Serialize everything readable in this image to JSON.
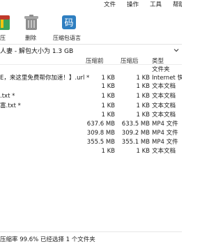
{
  "menu": {
    "items": [
      "文件",
      "操作",
      "工具",
      "帮助"
    ]
  },
  "toolbar": {
    "buttons": [
      {
        "label": "压",
        "icon": "zip-archive-icon"
      },
      {
        "label": "删除",
        "icon": "trash-bin-icon"
      },
      {
        "label": "压缩包语言",
        "icon": "language-book-icon"
      }
    ]
  },
  "address": {
    "path": "人妻 - 解包大小为 1.3 GB"
  },
  "columns": {
    "size": "压缩前",
    "packed": "压缩后",
    "type": "类型"
  },
  "rows": [
    {
      "name": "",
      "size": "",
      "packed": "",
      "type": "文件夹"
    },
    {
      "name": "E，来这里免费帮你加速！】.url *",
      "size": "1 KB",
      "packed": "1 KB",
      "type": "Internet 快捷方式"
    },
    {
      "name": "",
      "size": "1 KB",
      "packed": "1 KB",
      "type": "文本文档"
    },
    {
      "name": ".txt *",
      "size": "1 KB",
      "packed": "1 KB",
      "type": "文本文档"
    },
    {
      "name": "富.txt *",
      "size": "1 KB",
      "packed": "1 KB",
      "type": "文本文档"
    },
    {
      "name": "",
      "size": "1 KB",
      "packed": "1 KB",
      "type": "文本文档"
    },
    {
      "name": "",
      "size": "637.6 MB",
      "packed": "633.5 MB",
      "type": "MP4 文件"
    },
    {
      "name": "",
      "size": "309.8 MB",
      "packed": "309.2 MB",
      "type": "MP4 文件"
    },
    {
      "name": "",
      "size": "355.5 MB",
      "packed": "355.1 MB",
      "type": "MP4 文件"
    },
    {
      "name": "",
      "size": "1 KB",
      "packed": "1 KB",
      "type": "文本文档"
    }
  ],
  "status": {
    "text": "压缩率 99.6% 已经选择 1 个文件夹"
  },
  "colors": {
    "icon_green": "#3aa35b",
    "icon_blue": "#2f7fc1",
    "icon_gray": "#8e8e8e"
  }
}
